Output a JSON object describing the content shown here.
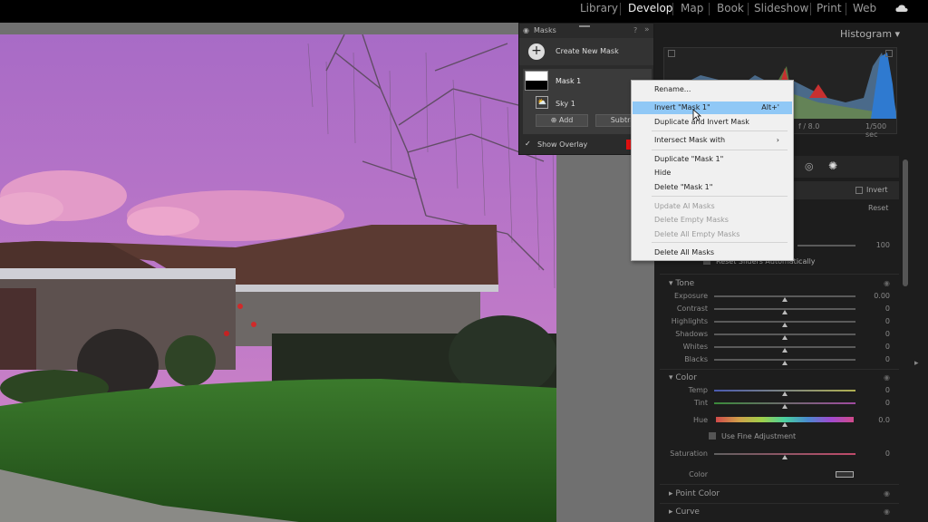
{
  "top_modules": [
    "Library",
    "Develop",
    "Map",
    "Book",
    "Slideshow",
    "Print",
    "Web"
  ],
  "active_module": "Develop",
  "histogram": {
    "title": "Histogram",
    "aperture": "f / 8.0",
    "shutter": "1/500 sec"
  },
  "masks_panel": {
    "title": "Masks",
    "create_label": "Create New Mask",
    "mask_name": "Mask 1",
    "component_name": "Sky 1",
    "add_label": "Add",
    "subtract_label": "Subtra",
    "show_overlay_label": "Show Overlay"
  },
  "context_menu": {
    "items": [
      {
        "label": "Rename...",
        "shortcut": "",
        "disabled": false,
        "highlighted": false
      },
      {
        "label": "Invert \"Mask 1\"",
        "shortcut": "Alt+'",
        "disabled": false,
        "highlighted": true
      },
      {
        "label": "Duplicate and Invert Mask",
        "shortcut": "",
        "disabled": false,
        "highlighted": false
      },
      {
        "label": "Intersect Mask with",
        "shortcut": "›",
        "disabled": false,
        "highlighted": false
      },
      {
        "label": "Duplicate \"Mask 1\"",
        "shortcut": "",
        "disabled": false,
        "highlighted": false
      },
      {
        "label": "Hide",
        "shortcut": "",
        "disabled": false,
        "highlighted": false
      },
      {
        "label": "Delete \"Mask 1\"",
        "shortcut": "",
        "disabled": false,
        "highlighted": false
      },
      {
        "label": "Update AI Masks",
        "shortcut": "",
        "disabled": true,
        "highlighted": false
      },
      {
        "label": "Delete Empty Masks",
        "shortcut": "",
        "disabled": true,
        "highlighted": false
      },
      {
        "label": "Delete All Empty Masks",
        "shortcut": "",
        "disabled": true,
        "highlighted": false
      },
      {
        "label": "Delete All Masks",
        "shortcut": "",
        "disabled": false,
        "highlighted": false
      }
    ]
  },
  "mask_settings": {
    "invert_label": "Invert",
    "reset_label": "Reset",
    "amount_value": "100",
    "reset_sliders_label": "Reset Sliders Automatically"
  },
  "tone": {
    "header": "Tone",
    "rows": [
      {
        "label": "Exposure",
        "value": "0.00"
      },
      {
        "label": "Contrast",
        "value": "0"
      },
      {
        "label": "Highlights",
        "value": "0"
      },
      {
        "label": "Shadows",
        "value": "0"
      },
      {
        "label": "Whites",
        "value": "0"
      },
      {
        "label": "Blacks",
        "value": "0"
      }
    ]
  },
  "color": {
    "header": "Color",
    "temp_label": "Temp",
    "temp_value": "0",
    "tint_label": "Tint",
    "tint_value": "0",
    "hue_label": "Hue",
    "hue_value": "0.0",
    "fine_adjust_label": "Use Fine Adjustment",
    "saturation_label": "Saturation",
    "saturation_value": "0",
    "color_label": "Color"
  },
  "point_color_header": "Point Color",
  "curve_header": "Curve",
  "colors": {
    "accent": "#90c8f6",
    "overlay_red": "#e01010"
  }
}
